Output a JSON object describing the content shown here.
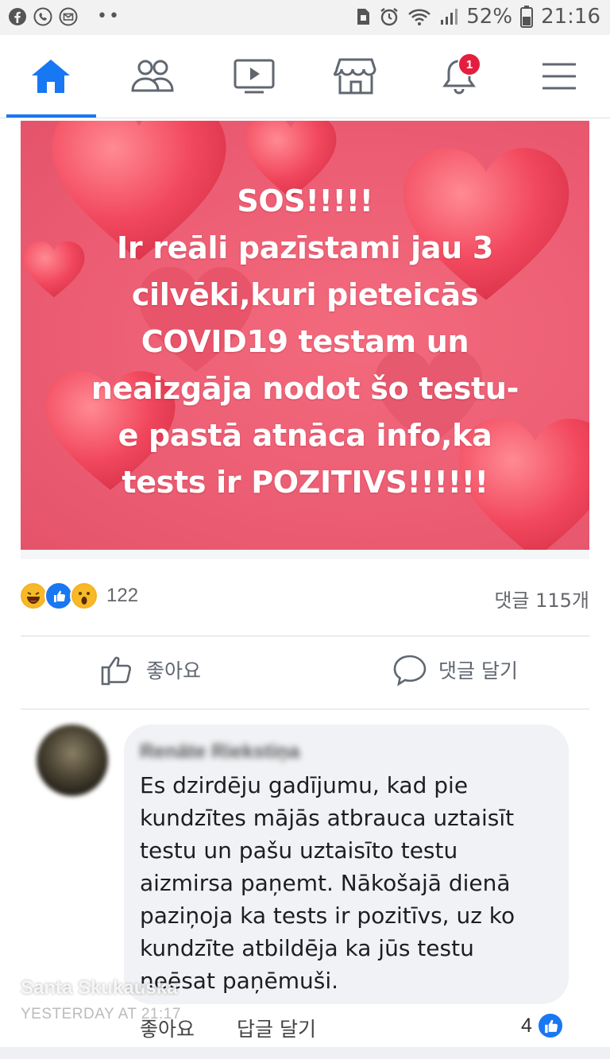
{
  "status_bar": {
    "battery": "52%",
    "time": "21:16",
    "left_icons": [
      "facebook-icon",
      "phone-icon",
      "mail-icon",
      "more-dots-icon"
    ],
    "right_icons": [
      "sim-icon",
      "alarm-icon",
      "wifi-icon",
      "signal-icon",
      "battery-icon"
    ]
  },
  "nav": {
    "items": [
      "home",
      "friends",
      "watch",
      "marketplace",
      "notifications",
      "menu"
    ],
    "active": "home",
    "notification_badge": "1",
    "accent_color": "#1877f2"
  },
  "post": {
    "image_text_lines": [
      "SOS!!!!!",
      "Ir reāli pazīstami jau 3",
      "cilvēki,kuri pieteicās",
      "COVID19 testam un",
      "neaizgāja nodot šo testu-",
      "e pastā atnāca info,ka",
      "tests ir POZITIVS!!!!!!"
    ],
    "image_bg_color": "#ec5d73",
    "reaction_count": "122",
    "comment_count": "댓글 115개",
    "like_label": "좋아요",
    "comment_label": "댓글 달기"
  },
  "comment": {
    "author": "Renāte Riekstiņa",
    "text_lines": [
      "Es dzirdēju gadījumu, kad pie",
      "kundzītes mājās atbrauca uztaisīt",
      "testu un pašu uztaisīto testu",
      "aizmirsa paņemt. Nākošajā dienā",
      "paziņoja ka tests ir pozitīvs, uz ko",
      "kundzīte atbildēja ka jūs testu",
      "neēsat paņēmuši."
    ],
    "like_label": "좋아요",
    "reply_label": "답글 달기",
    "like_count": "4"
  },
  "watermark": {
    "name": "Santa Skukauska",
    "time": "YESTERDAY AT 21:17"
  }
}
